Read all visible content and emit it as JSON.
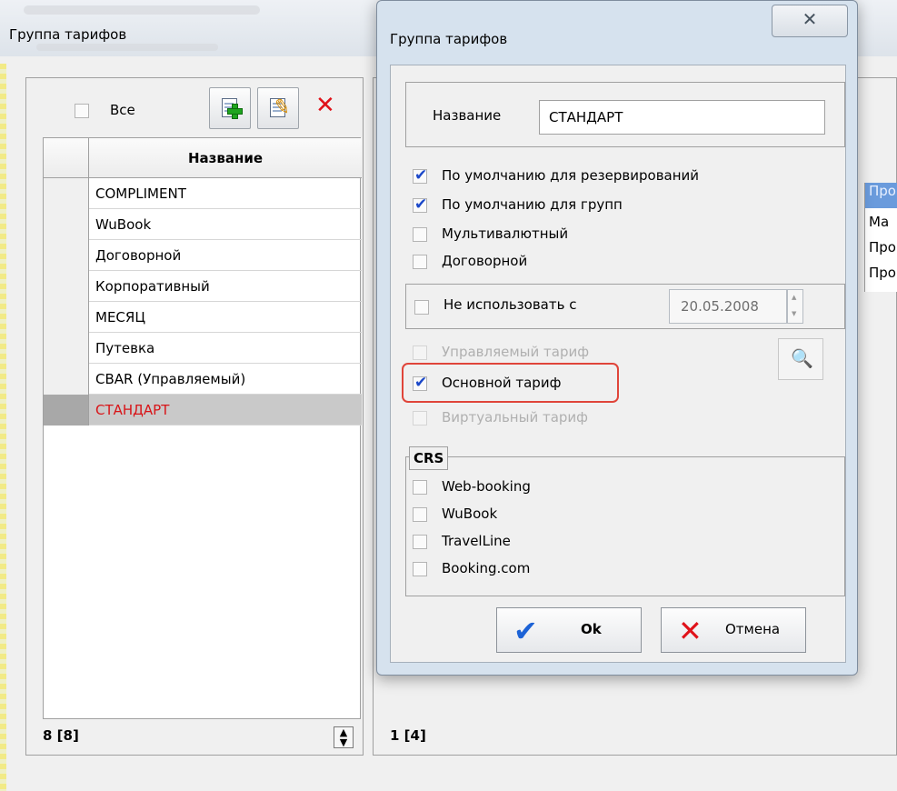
{
  "main_window": {
    "title": "Группа тарифов",
    "left": {
      "all_label": "Все",
      "column_header": "Название",
      "rows": [
        "COMPLIMENT",
        "WuBook",
        "Договорной",
        "Корпоративный",
        "МЕСЯЦ",
        "Путевка",
        "CBAR (Управляемый)",
        "СТАНДАРТ"
      ],
      "selected_index": 7,
      "status": "8 [8]"
    },
    "right": {
      "cells": [
        "Про",
        "Ма",
        "Про",
        "Про"
      ],
      "status": "1 [4]"
    }
  },
  "dialog": {
    "title": "Группа тарифов",
    "close_glyph": "✕",
    "name_label": "Название",
    "name_value": "СТАНДАРТ",
    "options": {
      "default_reservations": {
        "label": "По умолчанию для резервирований",
        "checked": true
      },
      "default_groups": {
        "label": "По умолчанию для групп",
        "checked": true
      },
      "multicurrency": {
        "label": "Мультивалютный",
        "checked": false
      },
      "contract": {
        "label": "Договорной",
        "checked": false
      },
      "not_use_since": {
        "label": "Не использовать с",
        "checked": false,
        "date": "20.05.2008"
      },
      "managed_tariff": {
        "label": "Управляемый тариф",
        "checked": false,
        "disabled": true
      },
      "main_tariff": {
        "label": "Основной тариф",
        "checked": true
      },
      "virtual_tariff": {
        "label": "Виртуальный тариф",
        "checked": false,
        "disabled": true
      }
    },
    "crs": {
      "title": "CRS",
      "items": [
        "Web-booking",
        "WuBook",
        "TravelLine",
        "Booking.com"
      ]
    },
    "buttons": {
      "ok": "Ok",
      "cancel": "Отмена"
    }
  },
  "colors": {
    "selection_text": "#d81418",
    "check_blue": "#1b48c9",
    "highlight_red": "#e0453a"
  }
}
